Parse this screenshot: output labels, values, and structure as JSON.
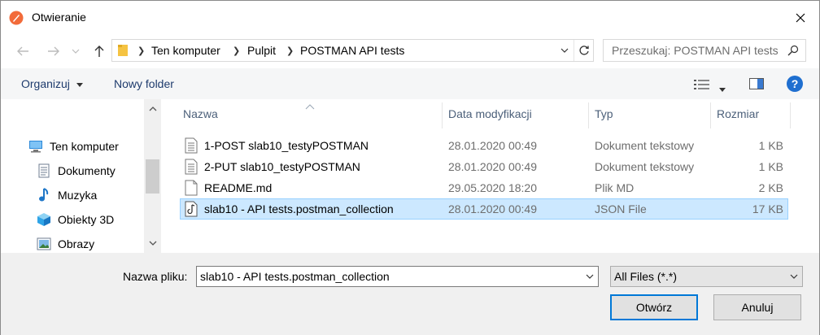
{
  "window": {
    "title": "Otwieranie"
  },
  "address_bar": {
    "breadcrumbs": [
      "Ten komputer",
      "Pulpit",
      "POSTMAN API tests"
    ]
  },
  "search": {
    "placeholder": "Przeszukaj: POSTMAN API tests"
  },
  "toolbar": {
    "organize_label": "Organizuj",
    "new_folder_label": "Nowy folder"
  },
  "sidebar": {
    "items": [
      {
        "label": "Ten komputer",
        "icon": "computer-icon"
      },
      {
        "label": "Dokumenty",
        "icon": "documents-icon"
      },
      {
        "label": "Muzyka",
        "icon": "music-icon"
      },
      {
        "label": "Obiekty 3D",
        "icon": "cube-3d-icon"
      },
      {
        "label": "Obrazy",
        "icon": "pictures-icon"
      }
    ]
  },
  "file_list": {
    "columns": [
      "Nazwa",
      "Data modyfikacji",
      "Typ",
      "Rozmiar"
    ],
    "rows": [
      {
        "name": "1-POST slab10_testyPOSTMAN",
        "date": "28.01.2020 00:49",
        "type": "Dokument tekstowy",
        "size": "1 KB",
        "icon": "text-document-icon",
        "selected": false
      },
      {
        "name": "2-PUT slab10_testyPOSTMAN",
        "date": "28.01.2020 00:49",
        "type": "Dokument tekstowy",
        "size": "1 KB",
        "icon": "text-document-icon",
        "selected": false
      },
      {
        "name": "README.md",
        "date": "29.05.2020 18:20",
        "type": "Plik MD",
        "size": "2 KB",
        "icon": "file-icon",
        "selected": false
      },
      {
        "name": "slab10 - API tests.postman_collection",
        "date": "28.01.2020 00:49",
        "type": "JSON File",
        "size": "17 KB",
        "icon": "json-file-icon",
        "selected": true
      }
    ]
  },
  "footer": {
    "filename_label": "Nazwa pliku:",
    "filename_value": "slab10 - API tests.postman_collection",
    "filetype_value": "All Files (*.*)",
    "open_label": "Otwórz",
    "cancel_label": "Anuluj"
  },
  "colors": {
    "selection_bg": "#cce8ff",
    "selection_border": "#99d1ff",
    "accent": "#0078d7",
    "header_text": "#4c607a"
  }
}
